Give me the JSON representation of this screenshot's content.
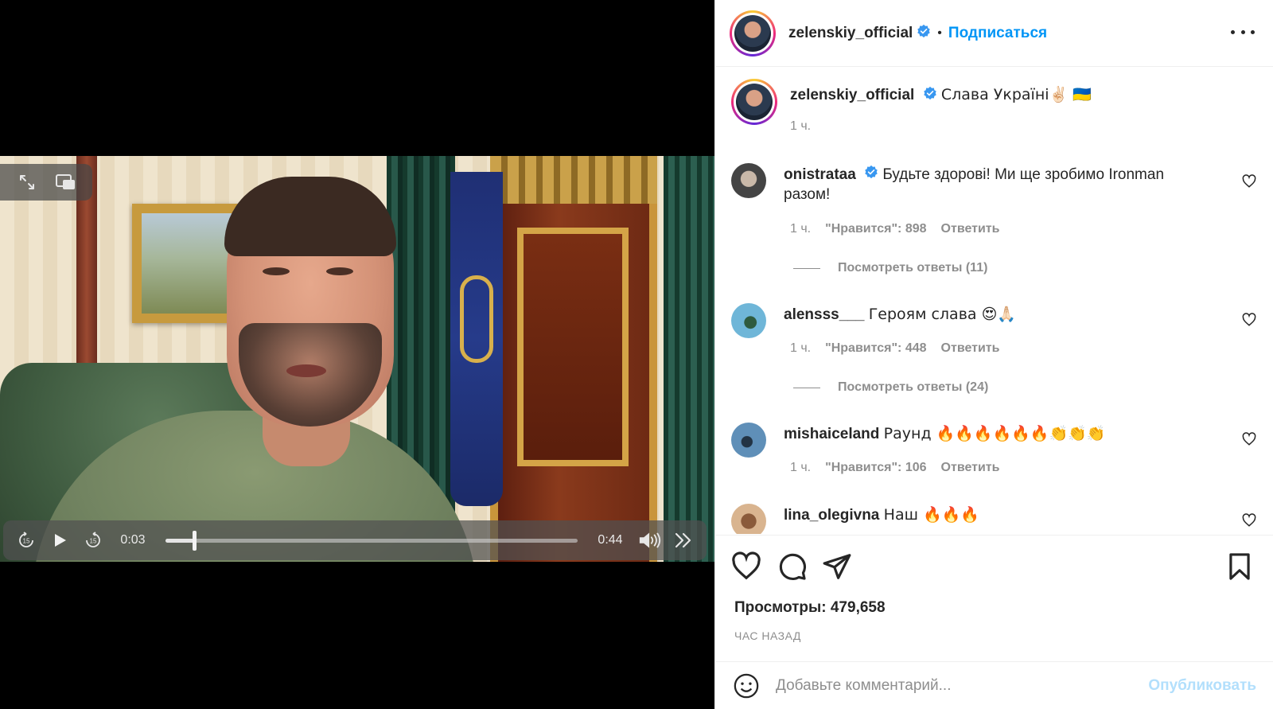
{
  "video": {
    "current_time": "0:03",
    "duration": "0:44",
    "progress": 0.07
  },
  "header": {
    "username": "zelenskiy_official",
    "separator": "•",
    "follow_label": "Подписаться"
  },
  "caption": {
    "username": "zelenskiy_official",
    "text": "Слава Україні✌🏻 🇺🇦",
    "time": "1 ч."
  },
  "comments": [
    {
      "username": "onistrataa",
      "verified": true,
      "text": "Будьте здорові! Ми ще зробимо Ironman разом!",
      "time": "1 ч.",
      "likes": "\"Нравится\": 898",
      "reply_label": "Ответить",
      "view_replies": "Посмотреть ответы (11)"
    },
    {
      "username": "alensss___",
      "verified": false,
      "text": "Героям слава 😍🙏🏻",
      "time": "1 ч.",
      "likes": "\"Нравится\": 448",
      "reply_label": "Ответить",
      "view_replies": "Посмотреть ответы (24)"
    },
    {
      "username": "mishaiceland",
      "verified": false,
      "text": "Раунд 🔥🔥🔥🔥🔥🔥👏👏👏",
      "time": "1 ч.",
      "likes": "\"Нравится\": 106",
      "reply_label": "Ответить"
    },
    {
      "username": "lina_olegivna",
      "verified": false,
      "text": "Наш 🔥🔥🔥"
    }
  ],
  "stats": {
    "views": "Просмотры: 479,658",
    "posted": "ЧАС НАЗАД"
  },
  "composer": {
    "placeholder": "Добавьте комментарий...",
    "publish_label": "Опубликовать"
  },
  "colors": {
    "link_blue": "#0095f6",
    "publish_disabled": "#b2dffc",
    "verified_blue": "#3897f0",
    "muted": "#8e8e8e"
  },
  "icons": [
    "expand-icon",
    "picture-in-picture-icon",
    "rewind-15-icon",
    "play-icon",
    "forward-15-icon",
    "volume-icon",
    "skip-icon",
    "verified-icon",
    "more-icon",
    "heart-icon",
    "comment-icon",
    "share-icon",
    "bookmark-icon",
    "emoji-icon"
  ]
}
